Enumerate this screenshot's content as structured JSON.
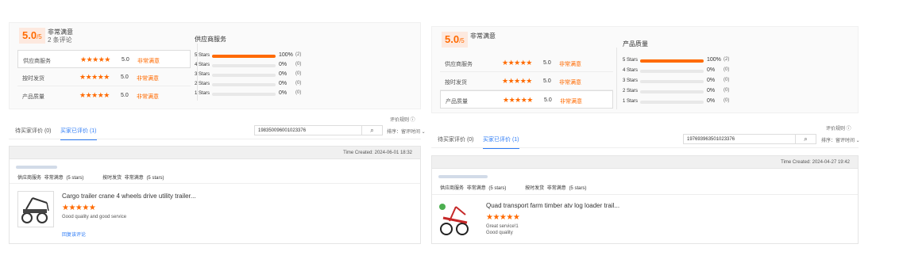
{
  "left": {
    "score": "5.0",
    "score_suffix": "/5",
    "overall_level": "非常满意",
    "review_count": "2 条评论",
    "categories": [
      {
        "name": "供应商服务",
        "stars": "★★★★★",
        "score": "5.0",
        "level": "非常满意"
      },
      {
        "name": "按时发货",
        "stars": "★★★★★",
        "score": "5.0",
        "level": "非常满意"
      },
      {
        "name": "产品质量",
        "stars": "★★★★★",
        "score": "5.0",
        "level": "非常满意"
      }
    ],
    "breakdown_title": "供应商服务",
    "bars": [
      {
        "label": "5 Stars",
        "pct": "100%",
        "count": "(2)",
        "fill": 1.0
      },
      {
        "label": "4 Stars",
        "pct": "0%",
        "count": "(0)",
        "fill": 0
      },
      {
        "label": "3 Stars",
        "pct": "0%",
        "count": "(0)",
        "fill": 0
      },
      {
        "label": "2 Stars",
        "pct": "0%",
        "count": "(0)",
        "fill": 0
      },
      {
        "label": "1 Stars",
        "pct": "0%",
        "count": "(0)",
        "fill": 0
      }
    ],
    "rules_link": "评价规则 ⓘ",
    "tab_pending": "待买家评价 (0)",
    "tab_reviewed": "买家已评价 (1)",
    "search_value": "198350096001023376",
    "sort_label": "排序：留评时间 ⌄",
    "review": {
      "time_created": "Time Created: 2024-06-01 18:32",
      "dims": [
        "供应商服务",
        "非常满意",
        "(5 stars)",
        "按时发货",
        "非常满意",
        "(5 stars)"
      ],
      "product_title": "Cargo trailer crane 4 wheels drive utility trailer...",
      "stars": "★★★★★",
      "text_lines": [
        "Good quality and good service"
      ],
      "reply": "回复该评论"
    }
  },
  "right": {
    "score": "5.0",
    "score_suffix": "/5",
    "overall_level": "非常满意",
    "review_count": "2 条评论",
    "categories": [
      {
        "name": "供应商服务",
        "stars": "★★★★★",
        "score": "5.0",
        "level": "非常满意"
      },
      {
        "name": "按时发货",
        "stars": "★★★★★",
        "score": "5.0",
        "level": "非常满意"
      },
      {
        "name": "产品质量",
        "stars": "★★★★★",
        "score": "5.0",
        "level": "非常满意"
      }
    ],
    "breakdown_title": "产品质量",
    "bars": [
      {
        "label": "5 Stars",
        "pct": "100%",
        "count": "(2)",
        "fill": 1.0
      },
      {
        "label": "4 Stars",
        "pct": "0%",
        "count": "(0)",
        "fill": 0
      },
      {
        "label": "3 Stars",
        "pct": "0%",
        "count": "(0)",
        "fill": 0
      },
      {
        "label": "2 Stars",
        "pct": "0%",
        "count": "(0)",
        "fill": 0
      },
      {
        "label": "1 Stars",
        "pct": "0%",
        "count": "(0)",
        "fill": 0
      }
    ],
    "rules_link": "评价规则 ⓘ",
    "tab_pending": "待买家评价 (0)",
    "tab_reviewed": "买家已评价 (1)",
    "search_value": "197693963501023376",
    "sort_label": "排序：留评时间 ⌄",
    "review": {
      "time_created": "Time Created: 2024-04-27 19:42",
      "dims": [
        "供应商服务",
        "非常满意",
        "(5 stars)",
        "按时发货",
        "非常满意",
        "(5 stars)"
      ],
      "product_title": "Quad transport farm timber atv log loader trail...",
      "stars": "★★★★★",
      "text_lines": [
        "Great service!1",
        "Good quality"
      ]
    }
  },
  "icons": {
    "search": "search-icon",
    "info": "info-icon",
    "chevron": "chevron-down-icon"
  },
  "colors": {
    "accent": "#ff6a00",
    "link": "#2e7cf6"
  }
}
